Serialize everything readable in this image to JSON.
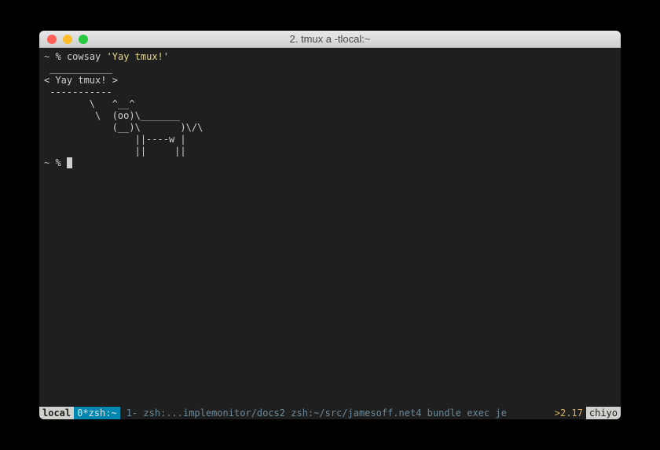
{
  "titlebar": {
    "title": "2. tmux a -tlocal:~"
  },
  "terminal": {
    "prompt1_dir": "~",
    "prompt1_sym": "%",
    "command": "cowsay",
    "arg": "'Yay tmux!'",
    "output_lines": [
      " ___________",
      "< Yay tmux! >",
      " -----------",
      "        \\   ^__^",
      "         \\  (oo)\\_______",
      "            (__)\\       )\\/\\",
      "                ||----w |",
      "                ||     ||"
    ],
    "prompt2_dir": "~",
    "prompt2_sym": "%"
  },
  "statusbar": {
    "session": "local",
    "active_window": {
      "index": "0*",
      "name": "zsh:~"
    },
    "windows": [
      {
        "index": "1-",
        "name": "zsh:...implemonitor/docs"
      },
      {
        "index": "2",
        "name": "zsh:~/src/jamesoff.net"
      },
      {
        "index": "4",
        "name": "bundle exec je"
      }
    ],
    "time_prefix": ">",
    "time": "2.17",
    "host": "chiyo"
  }
}
